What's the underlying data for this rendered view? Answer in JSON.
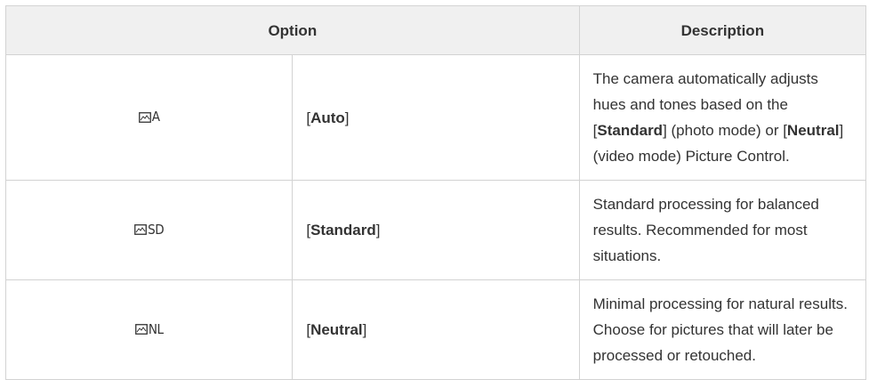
{
  "table": {
    "headers": {
      "option": "Option",
      "description": "Description"
    },
    "rows": [
      {
        "icon_name": "picture-control-auto-icon",
        "icon_suffix": "A",
        "option_label": "Auto",
        "description_parts": [
          "The camera automatically adjusts hues and tones based on the [",
          "Standard",
          "] (photo mode) or [",
          "Neutral",
          "] (video mode) Picture Control."
        ]
      },
      {
        "icon_name": "picture-control-standard-icon",
        "icon_suffix": "SD",
        "option_label": "Standard",
        "description": "Standard processing for balanced results. Recommended for most situations."
      },
      {
        "icon_name": "picture-control-neutral-icon",
        "icon_suffix": "NL",
        "option_label": "Neutral",
        "description": "Minimal processing for natural results. Choose for pictures that will later be processed or retouched."
      }
    ]
  }
}
